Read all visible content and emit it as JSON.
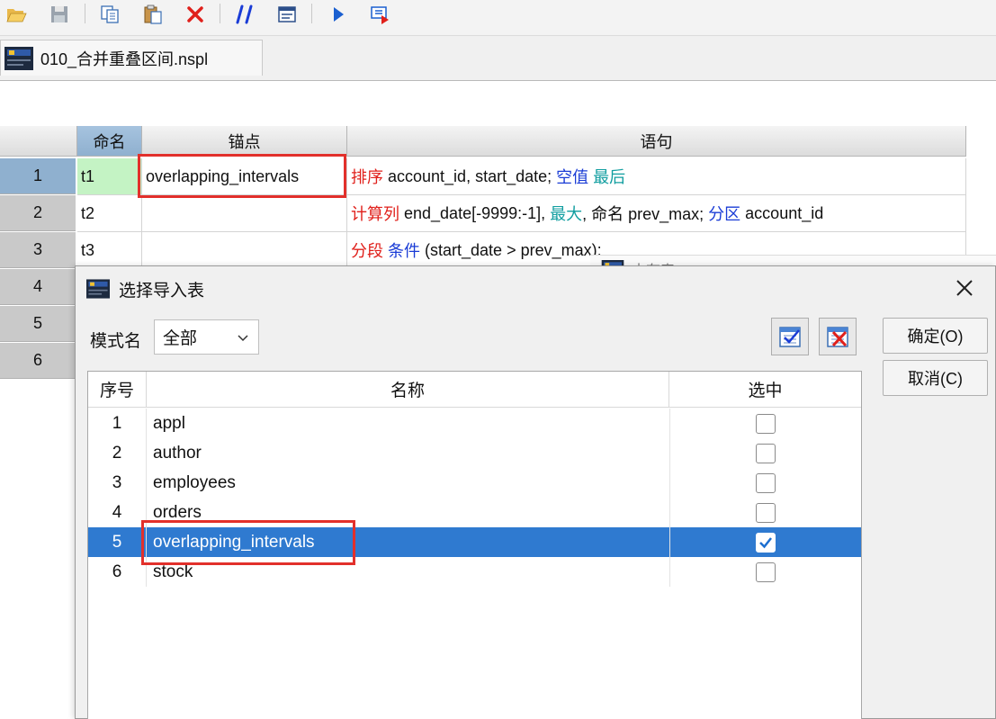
{
  "file_tab": {
    "label": "010_合并重叠区间.nspl"
  },
  "grid": {
    "headers": [
      "命名",
      "锚点",
      "语句"
    ],
    "row_numbers": [
      "1",
      "2",
      "3",
      "4",
      "5",
      "6"
    ],
    "rows": [
      {
        "name": "t1",
        "anchor": "overlapping_intervals",
        "statement": [
          {
            "text": "排序",
            "style": "red"
          },
          {
            "text": " account_id, start_date; ",
            "style": "plain"
          },
          {
            "text": "空值",
            "style": "blue"
          },
          {
            "text": " ",
            "style": "plain"
          },
          {
            "text": "最后",
            "style": "teal"
          }
        ]
      },
      {
        "name": "t2",
        "anchor": "",
        "statement": [
          {
            "text": "计算列",
            "style": "red"
          },
          {
            "text": " end_date[-9999:-1], ",
            "style": "plain"
          },
          {
            "text": "最大",
            "style": "teal"
          },
          {
            "text": ", 命名 prev_max; ",
            "style": "plain"
          },
          {
            "text": "分区",
            "style": "blue"
          },
          {
            "text": " account_id",
            "style": "plain"
          }
        ]
      },
      {
        "name": "t3",
        "anchor": "",
        "statement": [
          {
            "text": "分段",
            "style": "red"
          },
          {
            "text": " ",
            "style": "plain"
          },
          {
            "text": "条件",
            "style": "blue"
          },
          {
            "text": " (start_date > prev_max); ",
            "style": "plain"
          }
        ]
      }
    ]
  },
  "background_window": {
    "title": "内存表"
  },
  "dialog": {
    "title": "选择导入表",
    "schema_label": "模式名",
    "schema_value": "全部",
    "ok_label": "确定(O)",
    "cancel_label": "取消(C)",
    "columns": [
      "序号",
      "名称",
      "选中"
    ],
    "items": [
      {
        "idx": "1",
        "name": "appl",
        "checked": false,
        "selected": false
      },
      {
        "idx": "2",
        "name": "author",
        "checked": false,
        "selected": false
      },
      {
        "idx": "3",
        "name": "employees",
        "checked": false,
        "selected": false
      },
      {
        "idx": "4",
        "name": "orders",
        "checked": false,
        "selected": false
      },
      {
        "idx": "5",
        "name": "overlapping_intervals",
        "checked": true,
        "selected": true
      },
      {
        "idx": "6",
        "name": "stock",
        "checked": false,
        "selected": false
      }
    ]
  },
  "colors": {
    "highlight": "#e2302b",
    "selection": "#2f7ad0",
    "keyword_red": "#e0201b",
    "keyword_blue": "#1a3cd6",
    "keyword_teal": "#119ea0"
  }
}
